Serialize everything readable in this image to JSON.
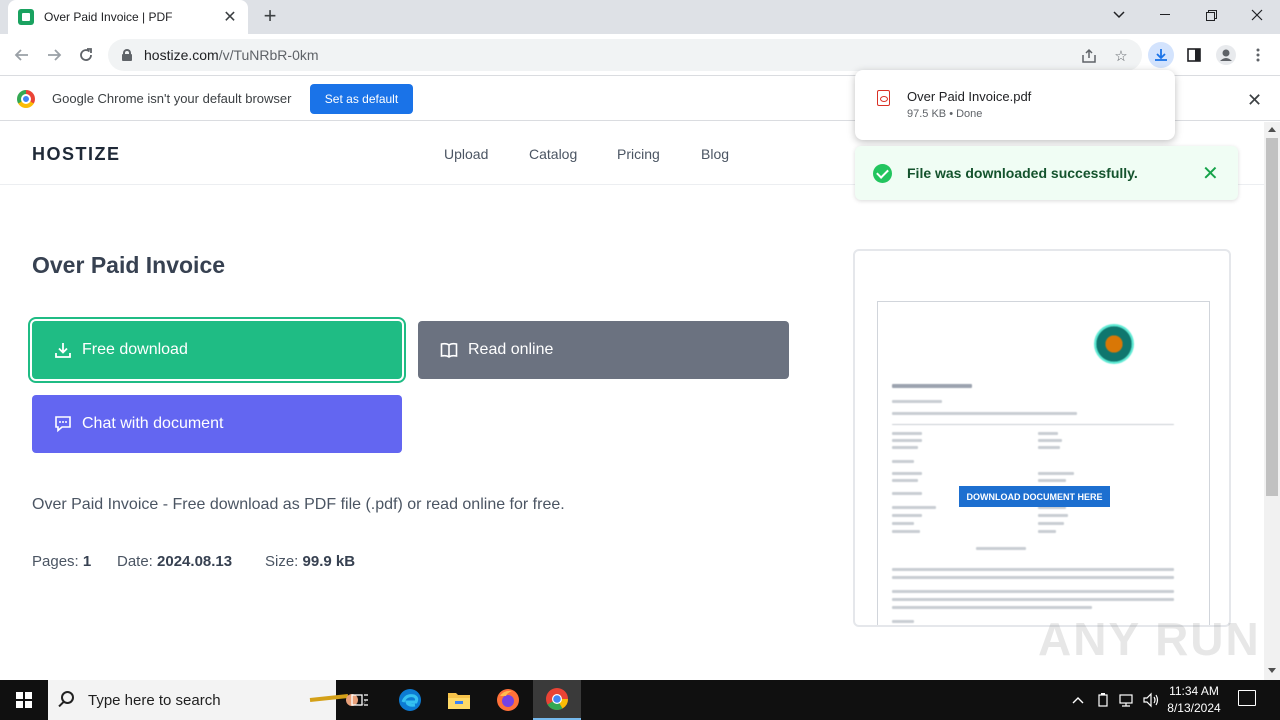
{
  "browser": {
    "tab_title": "Over Paid Invoice | PDF",
    "url_host": "hostize.com",
    "url_path": "/v/TuNRbR-0km"
  },
  "infobar": {
    "message": "Google Chrome isn't your default browser",
    "button": "Set as default"
  },
  "site": {
    "logo": "HOSTIZE",
    "nav": [
      "Upload",
      "Catalog",
      "Pricing",
      "Blog"
    ]
  },
  "main": {
    "title": "Over Paid Invoice",
    "free_download": "Free download",
    "read_online": "Read online",
    "chat": "Chat with document",
    "description": "Over Paid Invoice - Free download as PDF file (.pdf) or read online for free.",
    "meta": {
      "pages_label": "Pages:",
      "pages_value": "1",
      "date_label": "Date:",
      "date_value": "2024.08.13",
      "size_label": "Size:",
      "size_value": "99.9 kB"
    }
  },
  "preview": {
    "cta": "DOWNLOAD DOCUMENT HERE"
  },
  "download_bubble": {
    "file_name": "Over Paid Invoice.pdf",
    "status": "97.5 KB • Done"
  },
  "toast": {
    "message": "File was downloaded successfully."
  },
  "watermark": "ANY RUN",
  "taskbar": {
    "search_placeholder": "Type here to search",
    "time": "11:34 AM",
    "date": "8/13/2024"
  },
  "colors": {
    "free_download": "#1fbc84",
    "read_online": "#6b7280",
    "chat": "#6366f1",
    "chrome_blue": "#1a73e8"
  }
}
